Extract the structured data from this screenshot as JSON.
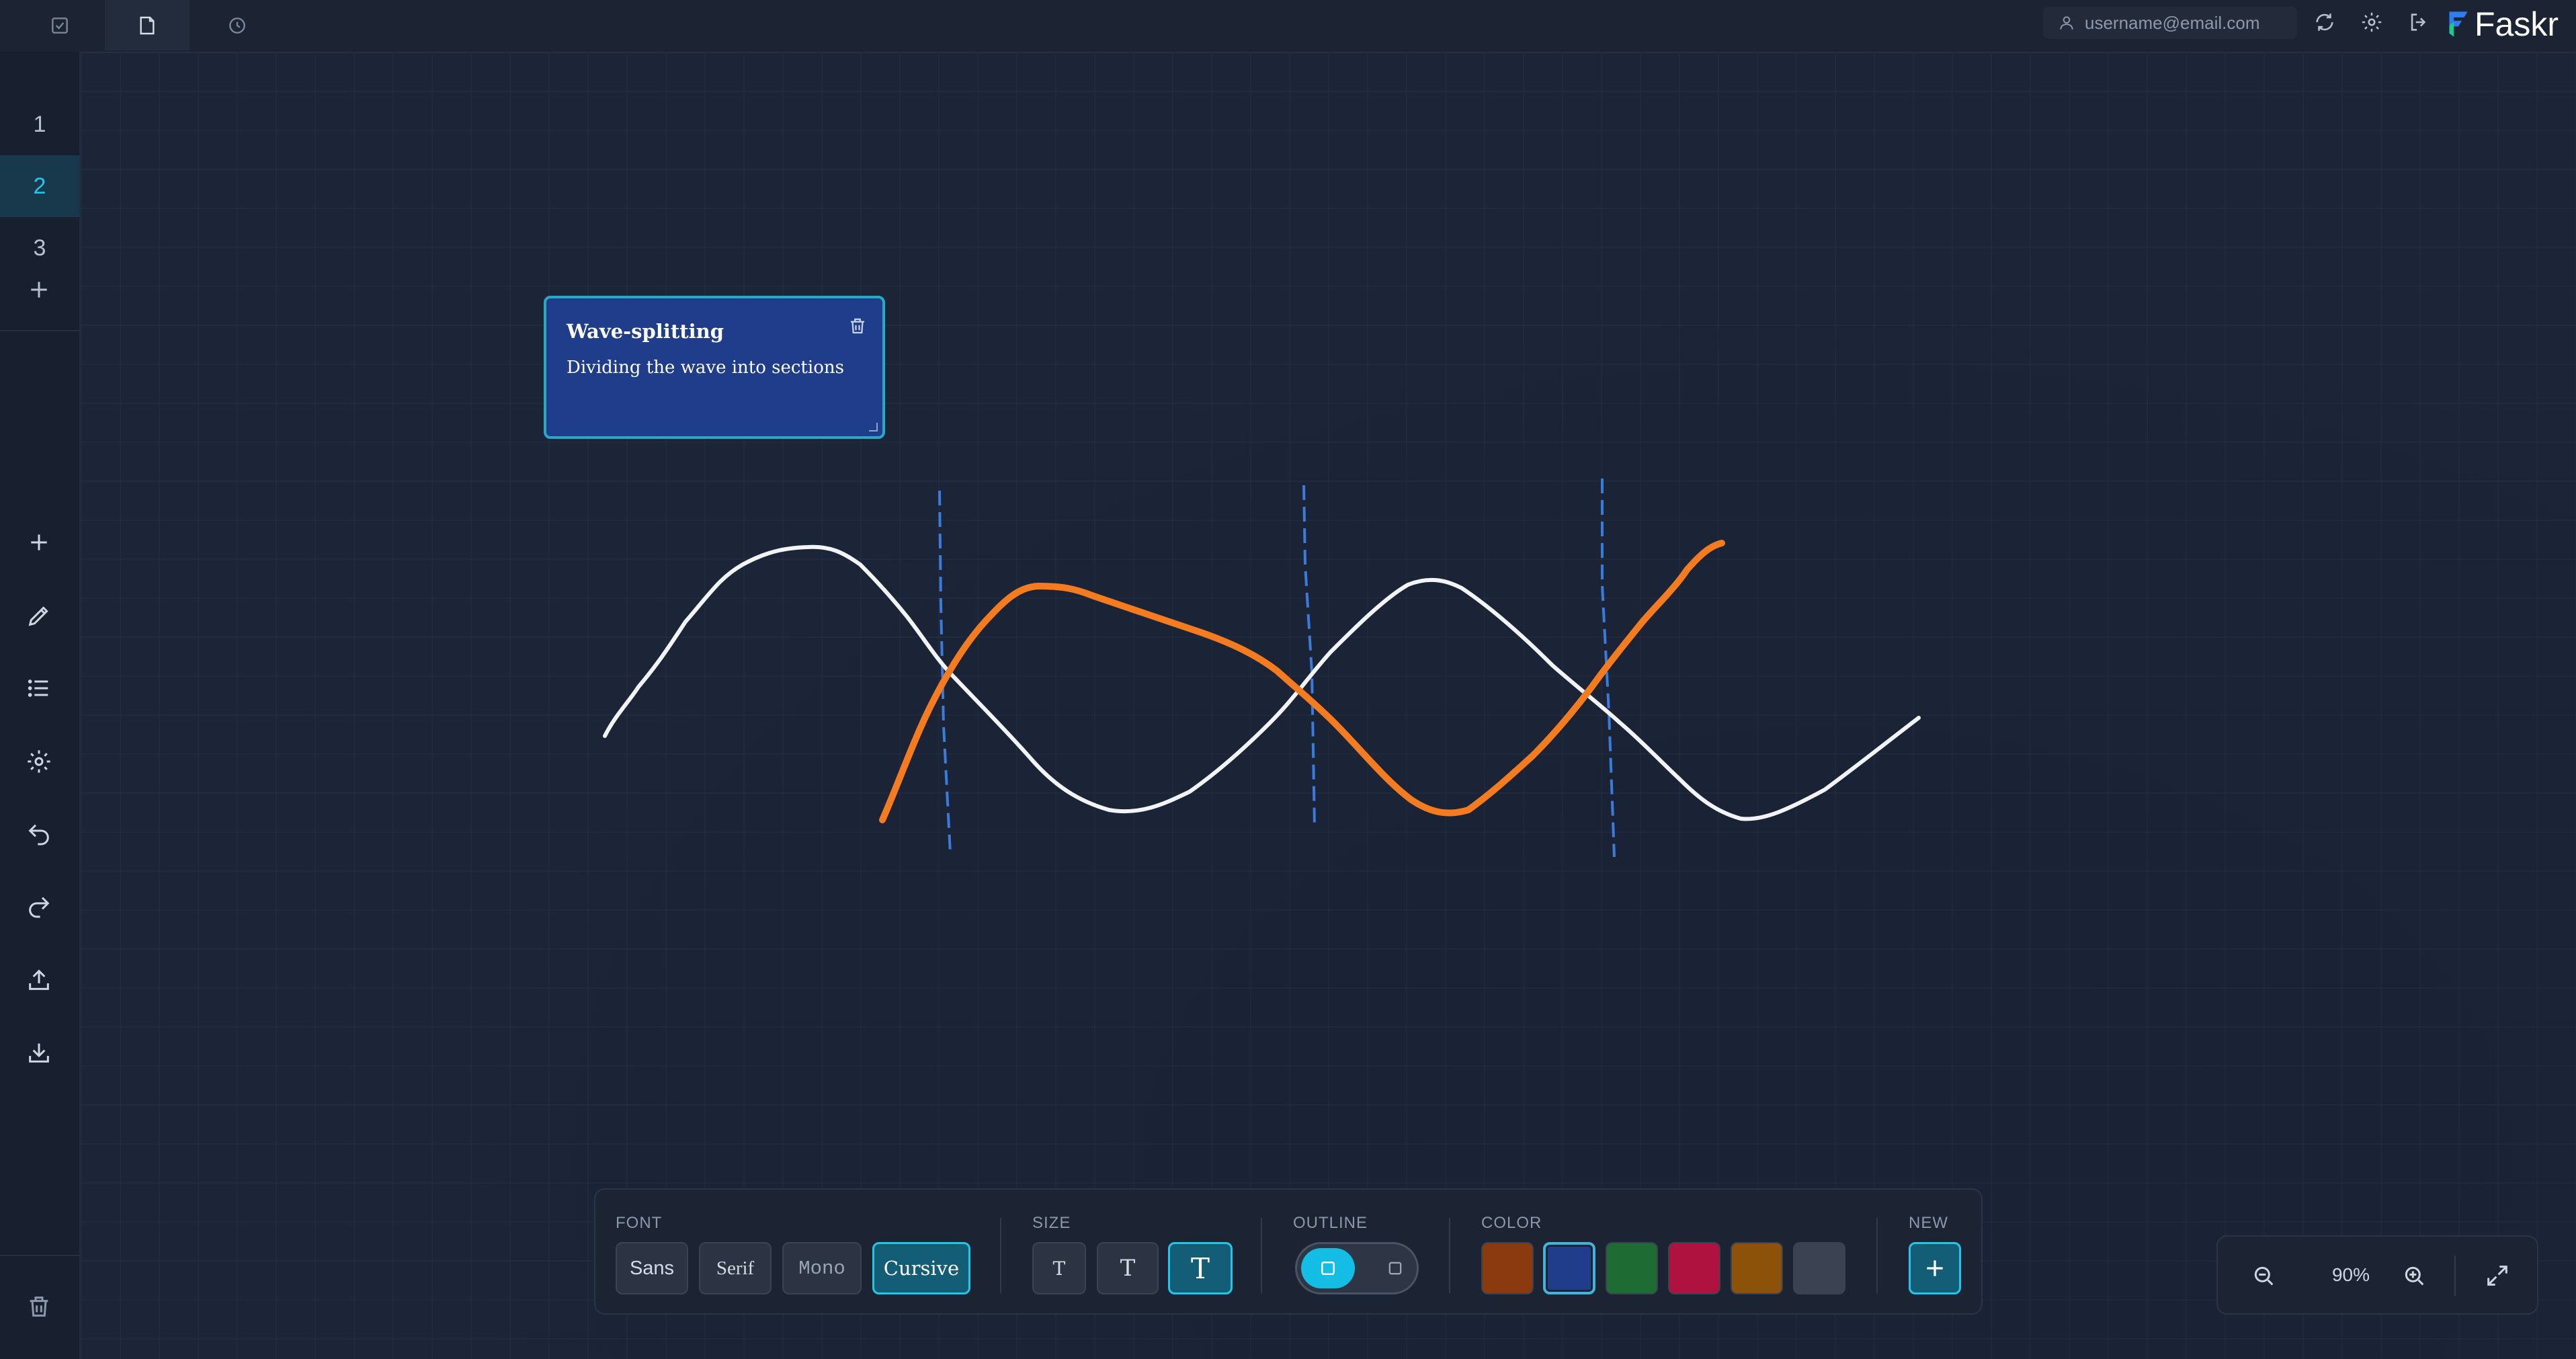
{
  "topbar": {
    "tabs": [
      {
        "icon": "checkbox-icon",
        "active": false
      },
      {
        "icon": "note-icon",
        "active": true
      },
      {
        "icon": "clock-icon",
        "active": false
      }
    ],
    "user_email": "username@email.com",
    "brand": "Faskr",
    "colors": {
      "brand_blue": "#2d7df0",
      "brand_green": "#1ec98a"
    }
  },
  "sidebar": {
    "pages": [
      "1",
      "2",
      "3"
    ],
    "active_page": "2",
    "tools": [
      "plus-icon",
      "pencil-icon",
      "list-icon",
      "gear-icon",
      "undo-icon",
      "redo-icon",
      "upload-icon",
      "download-icon"
    ]
  },
  "note": {
    "title": "Wave-splitting",
    "body": "Dividing the wave into sections",
    "color": "#1f3d8a"
  },
  "toolbar": {
    "font_label": "FONT",
    "fonts": [
      "Sans",
      "Serif",
      "Mono",
      "Cursive"
    ],
    "active_font": "Cursive",
    "size_label": "SIZE",
    "sizes": [
      "T",
      "T",
      "T"
    ],
    "active_size_index": 2,
    "outline_label": "OUTLINE",
    "outline_enabled": true,
    "color_label": "COLOR",
    "colors": [
      "#8b3a10",
      "#1f3d8a",
      "#1e6b34",
      "#b0123f",
      "#8c5209",
      "#3b4352"
    ],
    "selected_color": "#1f3d8a",
    "new_label": "NEW"
  },
  "zoom": {
    "level": "90%"
  },
  "accent": "#22c7e8"
}
